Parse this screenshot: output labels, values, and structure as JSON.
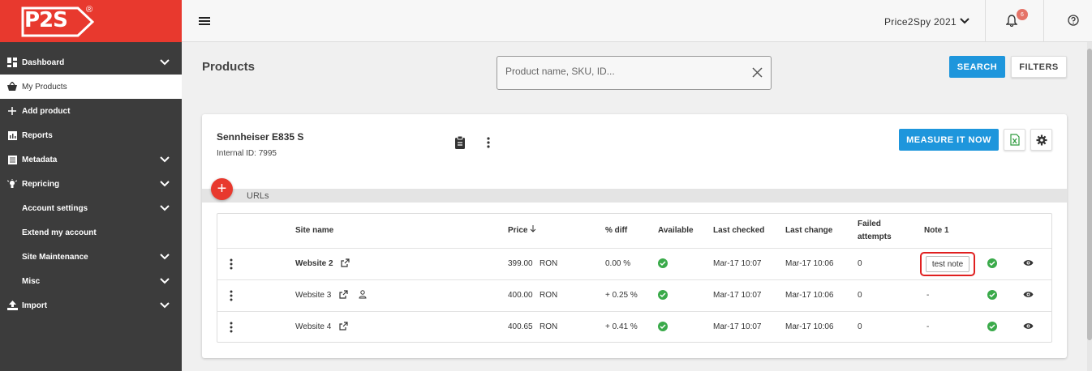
{
  "brand": {
    "logo_text": "P2S",
    "registered": "®"
  },
  "sidebar": {
    "items": [
      {
        "label": "Dashboard",
        "icon": "dashboard-icon",
        "chevron": true
      },
      {
        "label": "My Products",
        "icon": "basket-icon",
        "chevron": false,
        "active": true
      },
      {
        "label": "Add product",
        "icon": "plus-icon",
        "chevron": false
      },
      {
        "label": "Reports",
        "icon": "chart-icon",
        "chevron": false
      },
      {
        "label": "Metadata",
        "icon": "list-icon",
        "chevron": true
      },
      {
        "label": "Repricing",
        "icon": "lightbulb-icon",
        "chevron": true
      },
      {
        "label": "Account settings",
        "icon": "",
        "chevron": true
      },
      {
        "label": "Extend my account",
        "icon": "",
        "chevron": false
      },
      {
        "label": "Site Maintenance",
        "icon": "",
        "chevron": true
      },
      {
        "label": "Misc",
        "icon": "",
        "chevron": true
      },
      {
        "label": "Import",
        "icon": "upload-icon",
        "chevron": true
      }
    ]
  },
  "topbar": {
    "org_name": "Price2Spy 2021",
    "notification_count": "6"
  },
  "page": {
    "title": "Products",
    "search": {
      "placeholder": "Product name, SKU, ID...",
      "value": ""
    },
    "search_button": "SEARCH",
    "filters_button": "FILTERS"
  },
  "product": {
    "name": "Sennheiser E835 S",
    "internal_id": "Internal ID: 7995",
    "measure_button": "MEASURE IT NOW",
    "urls_label": "URLs",
    "add_symbol": "+",
    "table": {
      "headers": {
        "site": "Site name",
        "price": "Price",
        "diff": "% diff",
        "available": "Available",
        "checked": "Last checked",
        "change": "Last change",
        "failed_line1": "Failed",
        "failed_line2": "attempts",
        "note": "Note 1"
      },
      "rows": [
        {
          "site": "Website 2",
          "price": "399.00",
          "currency": "RON",
          "diff": "0.00 %",
          "checked": "Mar-17 10:07",
          "change": "Mar-17 10:06",
          "failed": "0",
          "note": "test note",
          "bold": true,
          "person": false
        },
        {
          "site": "Website 3",
          "price": "400.00",
          "currency": "RON",
          "diff": "+ 0.25 %",
          "checked": "Mar-17 10:07",
          "change": "Mar-17 10:06",
          "failed": "0",
          "note": "-",
          "bold": false,
          "person": true
        },
        {
          "site": "Website 4",
          "price": "400.65",
          "currency": "RON",
          "diff": "+ 0.41 %",
          "checked": "Mar-17 10:07",
          "change": "Mar-17 10:06",
          "failed": "0",
          "note": "-",
          "bold": false,
          "person": false
        }
      ]
    }
  },
  "colors": {
    "brand_red": "#e8392e",
    "accent_blue": "#1e96dc",
    "sidebar_bg": "#3c3c3c",
    "available_green": "#3aaa4a"
  }
}
